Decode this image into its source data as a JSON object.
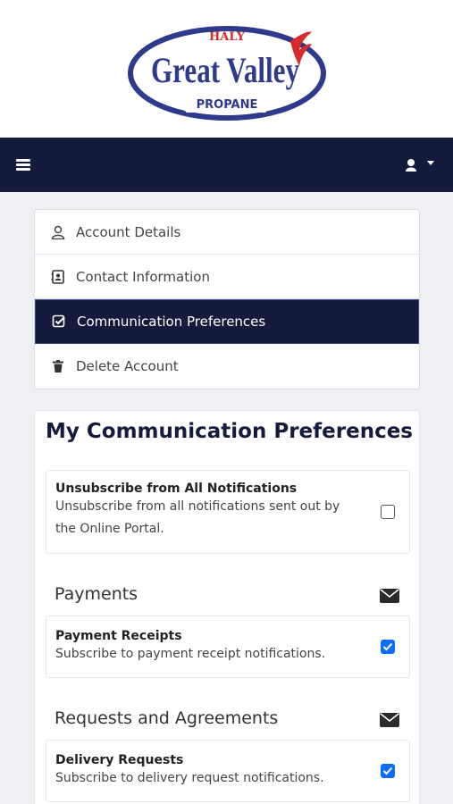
{
  "logo": {
    "top_text": "HALY",
    "main_text": "Great Valley",
    "bottom_text": "PROPANE"
  },
  "navbar": {
    "menu_icon": "hamburger-icon",
    "user_icon": "user-icon"
  },
  "menu": {
    "items": [
      {
        "label": "Account Details",
        "icon": "user-outline-icon",
        "active": false
      },
      {
        "label": "Contact Information",
        "icon": "contact-card-icon",
        "active": false
      },
      {
        "label": "Communication Preferences",
        "icon": "check-square-icon",
        "active": true
      },
      {
        "label": "Delete Account",
        "icon": "trash-icon",
        "active": false
      }
    ]
  },
  "preferences": {
    "title": "My Communication Preferences",
    "unsubscribe": {
      "title": "Unsubscribe from All Notifications",
      "desc_line1": "Unsubscribe from all notifications sent out by",
      "desc_line2": "the Online Portal.",
      "checked": false
    },
    "sections": [
      {
        "title": "Payments",
        "icon": "envelope-icon",
        "items": [
          {
            "title": "Payment Receipts",
            "desc": "Subscribe to payment receipt notifications.",
            "checked": true
          }
        ]
      },
      {
        "title": "Requests and Agreements",
        "icon": "envelope-icon",
        "items": [
          {
            "title": "Delivery Requests",
            "desc": "Subscribe to delivery request notifications.",
            "checked": true
          }
        ]
      }
    ]
  },
  "colors": {
    "navy": "#151b3d",
    "logo_blue": "#2e3a8c",
    "logo_red": "#d62b2b",
    "checkbox_blue": "#0d6efd"
  }
}
